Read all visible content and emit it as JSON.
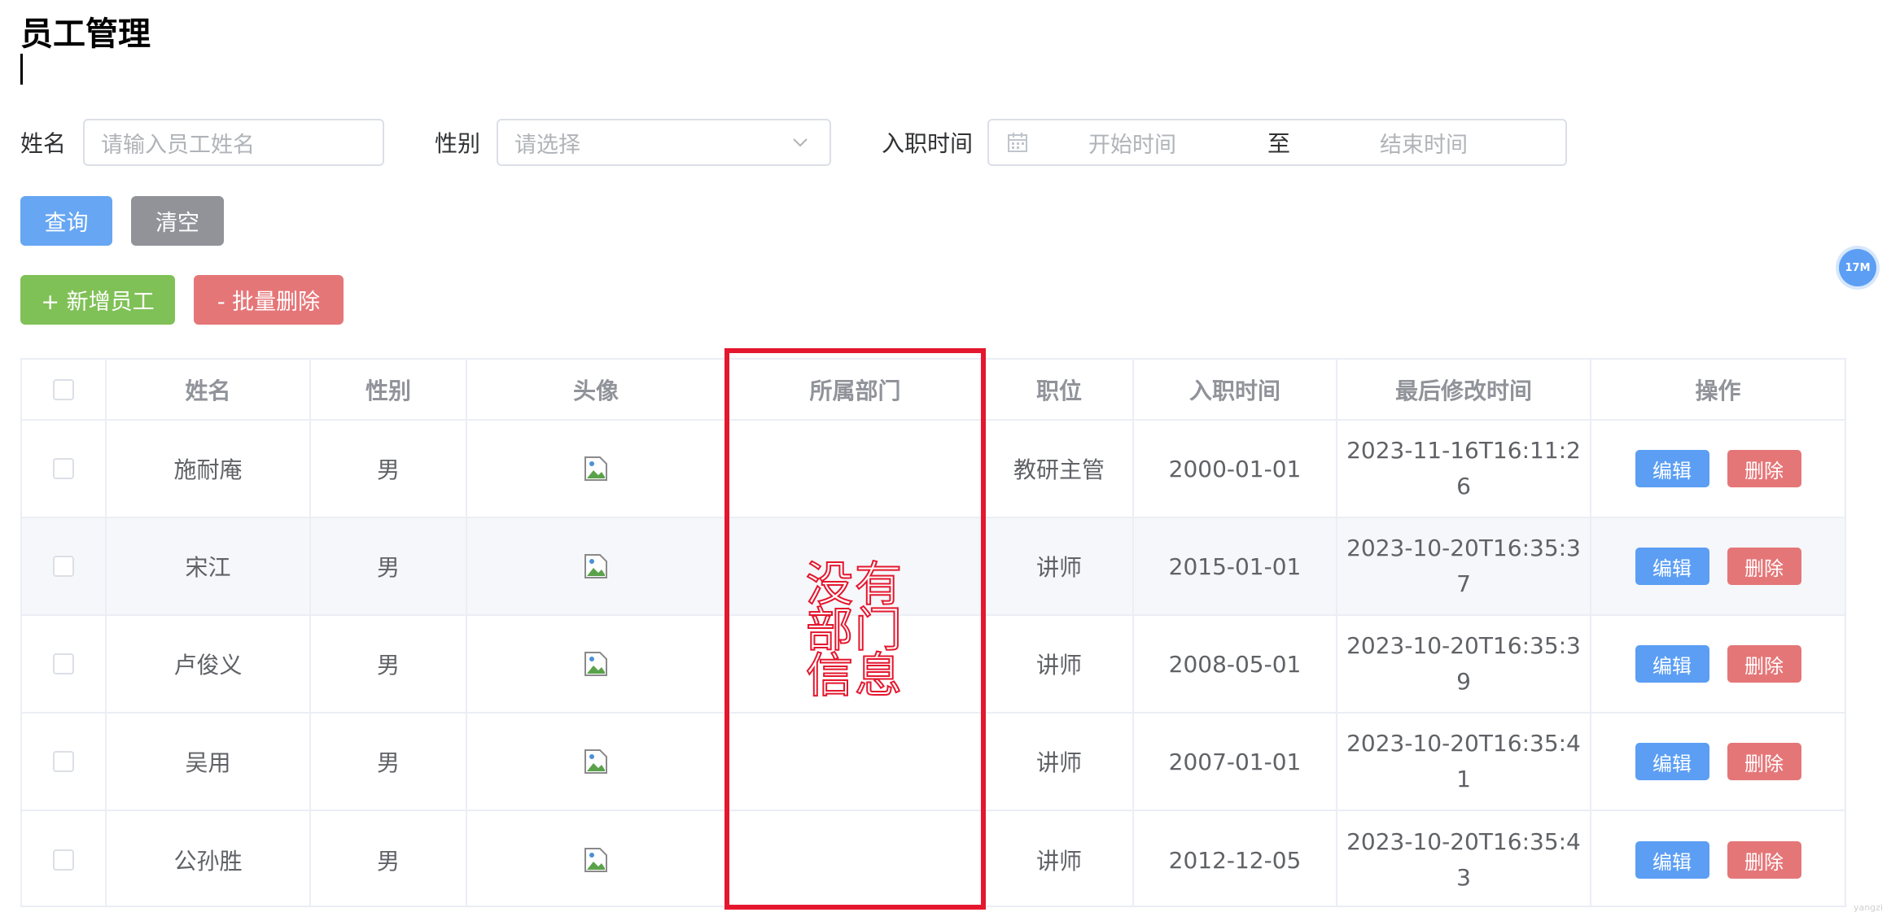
{
  "page": {
    "title": "员工管理"
  },
  "filters": {
    "name": {
      "label": "姓名",
      "placeholder": "请输入员工姓名"
    },
    "gender": {
      "label": "性别",
      "placeholder": "请选择"
    },
    "hire_date": {
      "label": "入职时间",
      "start_placeholder": "开始时间",
      "separator": "至",
      "end_placeholder": "结束时间"
    }
  },
  "buttons": {
    "query": "查询",
    "clear": "清空",
    "add": "+ 新增员工",
    "batch_delete": "- 批量删除"
  },
  "badge": "17M",
  "table": {
    "headers": {
      "name": "姓名",
      "gender": "性别",
      "avatar": "头像",
      "dept": "所属部门",
      "job": "职位",
      "entry_date": "入职时间",
      "update_time": "最后修改时间",
      "actions": "操作"
    },
    "action_labels": {
      "edit": "编辑",
      "delete": "删除"
    },
    "rows": [
      {
        "name": "施耐庵",
        "gender": "男",
        "dept": "",
        "job": "教研主管",
        "entry_date": "2000-01-01",
        "update_time": "2023-11-16T16:11:26"
      },
      {
        "name": "宋江",
        "gender": "男",
        "dept": "",
        "job": "讲师",
        "entry_date": "2015-01-01",
        "update_time": "2023-10-20T16:35:37"
      },
      {
        "name": "卢俊义",
        "gender": "男",
        "dept": "",
        "job": "讲师",
        "entry_date": "2008-05-01",
        "update_time": "2023-10-20T16:35:39"
      },
      {
        "name": "吴用",
        "gender": "男",
        "dept": "",
        "job": "讲师",
        "entry_date": "2007-01-01",
        "update_time": "2023-10-20T16:35:41"
      },
      {
        "name": "公孙胜",
        "gender": "男",
        "dept": "",
        "job": "讲师",
        "entry_date": "2012-12-05",
        "update_time": "2023-10-20T16:35:43"
      }
    ]
  },
  "annotation": {
    "text": "没有部门信息",
    "color": "#e4172e"
  },
  "watermark": "yangzi"
}
